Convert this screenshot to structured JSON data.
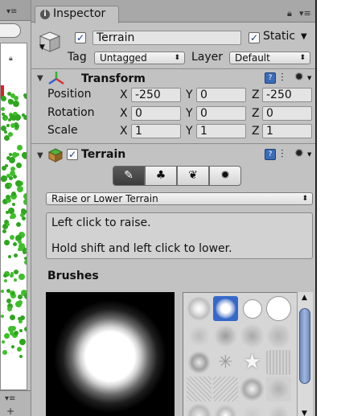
{
  "inspector_tab": {
    "label": "Inspector"
  },
  "object": {
    "name": "Terrain",
    "active": true,
    "static_label": "Static",
    "static": true,
    "tag_label": "Tag",
    "tag_value": "Untagged",
    "layer_label": "Layer",
    "layer_value": "Default"
  },
  "transform": {
    "title": "Transform",
    "rows": [
      {
        "label": "Position",
        "x": "-250",
        "y": "0",
        "z": "-250"
      },
      {
        "label": "Rotation",
        "x": "0",
        "y": "0",
        "z": "0"
      },
      {
        "label": "Scale",
        "x": "1",
        "y": "1",
        "z": "1"
      }
    ],
    "axis_labels": {
      "x": "X",
      "y": "Y",
      "z": "Z"
    }
  },
  "terrain": {
    "title": "Terrain",
    "enabled": true,
    "tools": [
      {
        "name": "paint-brush-tool",
        "icon": "brush-icon",
        "glyph": "✎",
        "active": true
      },
      {
        "name": "place-trees-tool",
        "icon": "tree-icon",
        "glyph": "♣",
        "active": false
      },
      {
        "name": "paint-details-tool",
        "icon": "grass-icon",
        "glyph": "❦",
        "active": false
      },
      {
        "name": "terrain-settings-tool",
        "icon": "gear-icon",
        "glyph": "✹",
        "active": false
      }
    ],
    "mode_dropdown": "Raise or Lower Terrain",
    "help_line1": "Left click to raise.",
    "help_line2": "Hold shift and left click to lower.",
    "brushes_label": "Brushes"
  }
}
